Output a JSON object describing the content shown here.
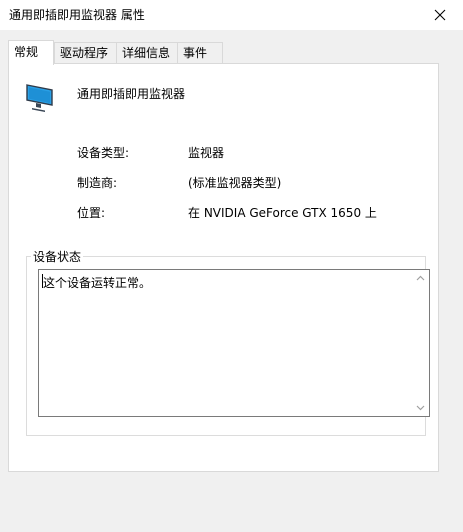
{
  "window": {
    "title": "通用即插即用监视器 属性",
    "close_icon": "close-icon"
  },
  "tabs": [
    {
      "label": "常规",
      "active": true
    },
    {
      "label": "驱动程序",
      "active": false
    },
    {
      "label": "详细信息",
      "active": false
    },
    {
      "label": "事件",
      "active": false
    }
  ],
  "general": {
    "device_icon": "monitor-icon",
    "device_name": "通用即插即用监视器",
    "properties": [
      {
        "label": "设备类型:",
        "value": "监视器"
      },
      {
        "label": "制造商:",
        "value": "(标准监视器类型)"
      },
      {
        "label": "位置:",
        "value": "在 NVIDIA GeForce GTX 1650 上"
      }
    ],
    "status_group_title": "设备状态",
    "status_text": "这个设备运转正常。"
  },
  "colors": {
    "window_bg": "#f0f0f0",
    "panel_bg": "#ffffff",
    "border": "#d9d9d9",
    "monitor_screen": "#1e90d6"
  }
}
